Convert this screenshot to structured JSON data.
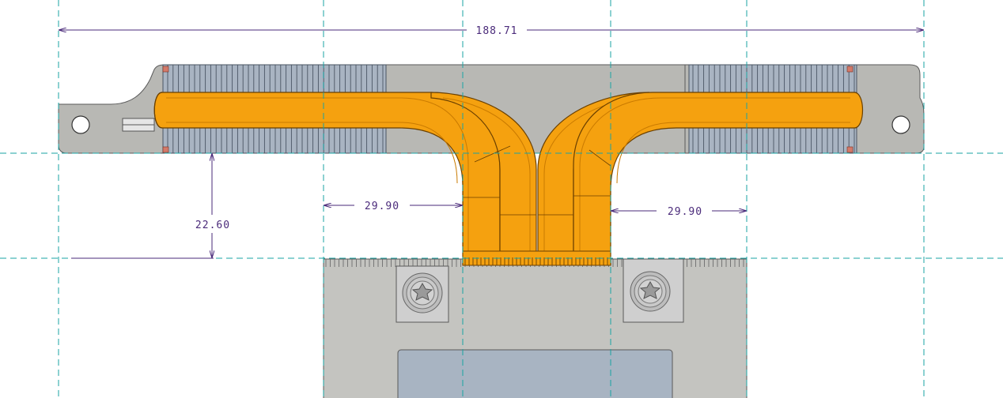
{
  "drawing": {
    "dimensions": {
      "overall_width": "188.71",
      "offset_left": "29.90",
      "offset_right": "29.90",
      "vertical_gap": "22.60"
    }
  },
  "colors": {
    "background": "#ffffff",
    "centerline": "#1aa3a3",
    "dimension": "#4a2a7a",
    "plate": "#b8b8b4",
    "plate_edge": "#5a5a5a",
    "fin": "#a9b4c2",
    "fin_line": "#4a5563",
    "pipe": "#f5a10f",
    "pipe_dark": "#c97a00",
    "pipe_edge": "#6b4000",
    "block": "#c4c4c0",
    "screw_pad": "#cfcfcf",
    "die_window": "#a8b4c2"
  }
}
